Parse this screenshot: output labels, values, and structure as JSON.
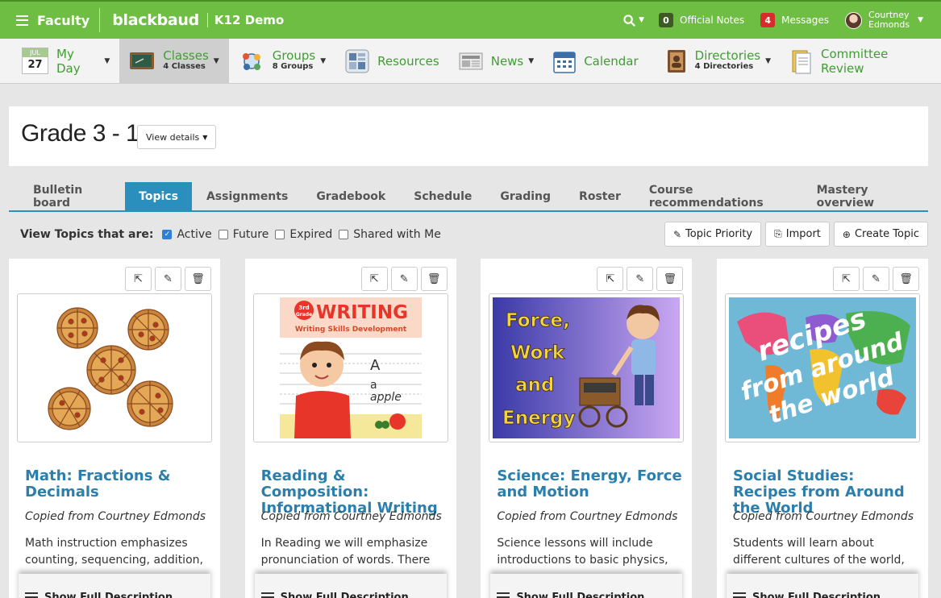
{
  "topbar": {
    "menu_label": "Faculty",
    "logo": "blackbaud",
    "demo": "K12 Demo",
    "notes_count": "0",
    "notes_label": "Official Notes",
    "messages_count": "4",
    "messages_label": "Messages",
    "user_first": "Courtney",
    "user_last": "Edmonds"
  },
  "nav": {
    "myday": {
      "month": "JUL",
      "day": "27",
      "label": "My Day"
    },
    "classes": {
      "label": "Classes",
      "sub": "4 Classes"
    },
    "groups": {
      "label": "Groups",
      "sub": "8 Groups"
    },
    "resources": {
      "label": "Resources"
    },
    "news": {
      "label": "News"
    },
    "calendar": {
      "label": "Calendar"
    },
    "directories": {
      "label": "Directories",
      "sub": "4 Directories"
    },
    "committee": {
      "label": "Committee Review"
    }
  },
  "page": {
    "title": "Grade 3 - 1",
    "view_details": "View details"
  },
  "tabs": [
    {
      "label": "Bulletin board"
    },
    {
      "label": "Topics"
    },
    {
      "label": "Assignments"
    },
    {
      "label": "Gradebook"
    },
    {
      "label": "Schedule"
    },
    {
      "label": "Grading"
    },
    {
      "label": "Roster"
    },
    {
      "label": "Course recommendations"
    },
    {
      "label": "Mastery overview"
    }
  ],
  "filters": {
    "label": "View Topics that are:",
    "options": [
      {
        "label": "Active",
        "checked": true
      },
      {
        "label": "Future",
        "checked": false
      },
      {
        "label": "Expired",
        "checked": false
      },
      {
        "label": "Shared with Me",
        "checked": false
      }
    ]
  },
  "actions": {
    "priority": "Topic Priority",
    "import": "Import",
    "create": "Create Topic"
  },
  "cards": [
    {
      "title": "Math: Fractions & Decimals",
      "copied": "Copied from Courtney Edmonds",
      "desc": "Math instruction emphasizes counting, sequencing, addition,",
      "show_full": "Show Full Description"
    },
    {
      "title": "Reading & Composition: Informational Writing",
      "copied": "Copied from Courtney Edmonds",
      "desc": "In Reading we will emphasize pronunciation of words.  There",
      "show_full": "Show Full Description",
      "image_text": {
        "grade_top": "3rd",
        "grade_bottom": "Grade",
        "heading": "WRITING",
        "subheading": "Writing Skills Development",
        "letter_big": "A",
        "letter_small": "a",
        "word": "apple"
      }
    },
    {
      "title": "Science: Energy, Force and Motion",
      "copied": "Copied from Courtney Edmonds",
      "desc": "Science lessons will include introductions to basic physics,",
      "show_full": "Show Full Description",
      "image_text": {
        "line1": "Force,",
        "line2": "Work",
        "line3": "and",
        "line4": "Energy"
      }
    },
    {
      "title": "Social Studies: Recipes from Around the World",
      "copied": "Copied from Courtney Edmonds",
      "desc": "Students will learn about different cultures of the world,",
      "show_full": "Show Full Description",
      "image_text": {
        "line1": "recipes",
        "line2": "from around",
        "line3": "the world"
      }
    }
  ]
}
